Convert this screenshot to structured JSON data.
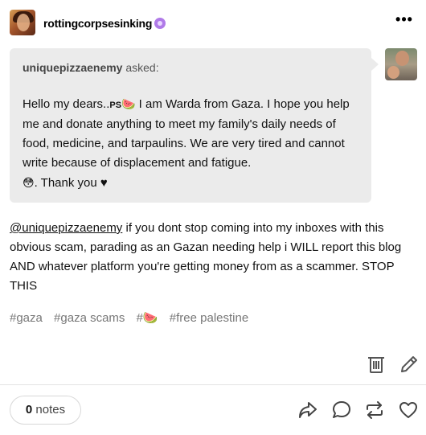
{
  "post": {
    "blog_name": "rottingcorpsesinking",
    "badge_icon": "purple-face-badge-icon",
    "more_icon": "ellipsis-icon",
    "ask": {
      "asker": "uniquepizzaenemy",
      "asked_label": "asked:",
      "text_part1": "Hello my dears..",
      "ps": "PS",
      "watermelon": "🍉",
      "text_part2": " I am Warda from Gaza. I hope you help me and donate anything to meet my family's daily needs of food, medicine, and tarpaulins. We are very tired and cannot write because of displacement and fatigue.",
      "sad_emoji": "😳",
      "text_part3": ". Thank you ♥"
    },
    "answer": {
      "mention": "@uniquepizzaenemy",
      "text": " if you dont stop coming into my inboxes with this obvious scam, parading as an Gazan needing help i WILL report this blog AND whatever platform you're  getting money from as a scammer. STOP THIS"
    },
    "tags": [
      "#gaza",
      "#gaza scams",
      "#🍉",
      "#free palestine"
    ]
  },
  "actions": {
    "delete_icon": "trash-icon",
    "edit_icon": "pencil-icon",
    "share_icon": "share-arrow-icon",
    "reply_icon": "comment-bubble-icon",
    "reblog_icon": "reblog-icon",
    "like_icon": "heart-icon"
  },
  "footer": {
    "notes_count": "0",
    "notes_label": "notes"
  },
  "colors": {
    "ask_background": "#ebebeb",
    "tag_text": "#777777",
    "badge": "#b07ae8"
  }
}
